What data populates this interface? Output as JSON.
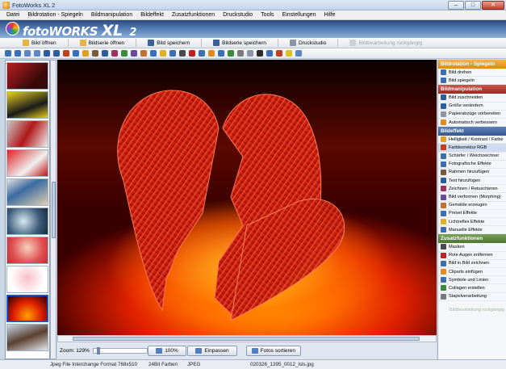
{
  "window": {
    "title": "FotoWorks XL 2",
    "minimize": "–",
    "maximize": "□",
    "close": "✕"
  },
  "menu": [
    "Datei",
    "Bildrotation - Spiegeln",
    "Bildmanipulation",
    "Bildeffekt",
    "Zusatzfunktionen",
    "Druckstudio",
    "Tools",
    "Einstellungen",
    "Hilfe"
  ],
  "banner": {
    "brand": "fotoWORKS",
    "xl": "XL",
    "version": "2"
  },
  "toolbar": {
    "open": "Bild öffnen",
    "open_series": "Bildserie öffnen",
    "save": "Bild speichern",
    "save_series": "Bildserie speichern",
    "print_studio": "Druckstudio",
    "undo": "Bildbearbeitung rückgängig"
  },
  "zoom": {
    "label": "Zoom: 129%",
    "btn_100": "100%",
    "btn_fit": "Einpassen",
    "btn_sort": "Fotos sortieren"
  },
  "panel": {
    "sections": [
      {
        "title": "Bildrotation - Spiegeln",
        "color": "orange",
        "items": [
          "Bild drehen",
          "Bild spiegeln"
        ]
      },
      {
        "title": "Bildmanipulation",
        "color": "red",
        "items": [
          "Bild zuschneiden",
          "Größe verändern",
          "Papierabzüge vorbereiten",
          "Automatisch verbessern"
        ]
      },
      {
        "title": "Bildeffekt",
        "color": "blue",
        "items": [
          "Helligkeit / Kontrast / Farbe",
          "Farbkorrektur RGB",
          "Schärfer / Weichzeichner",
          "Fotografische Effekte",
          "Rahmen hinzufügen",
          "Text hinzufügen",
          "Zeichnen / Retuschieren",
          "Bild verformen (Morphing)",
          "Gemälde erzeugen",
          "Preset Effekte",
          "Lichtreflex Effekte",
          "Manuelle Effekte"
        ]
      },
      {
        "title": "Zusatzfunktionen",
        "color": "green",
        "items": [
          "Masken",
          "Rote Augen entfernen",
          "Bild in Bild zeichnen",
          "Cliparts einfügen",
          "Symbole und Linien",
          "Collagen erstellen",
          "Stapelverarbeitung"
        ]
      }
    ],
    "undo": "Bildbearbeitung rückgängig"
  },
  "status": {
    "format": "Jpeg File Interchange Format",
    "dimensions": "768x510",
    "colors": "24Bit Farben",
    "type": "JPEG",
    "filename": "020326_1395_0012_lsls.jpg"
  }
}
